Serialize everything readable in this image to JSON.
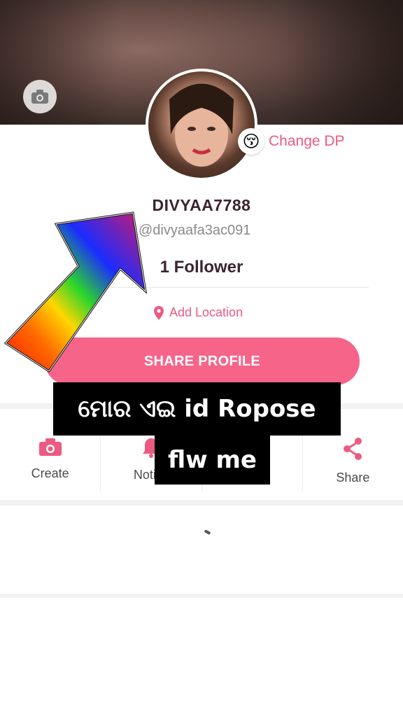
{
  "profile": {
    "username": "DIVYAA7788",
    "handle": "@divyaafa3ac091",
    "followers": "1 Follower",
    "change_dp_label": "Change DP",
    "change_dp_emoji": "😚",
    "add_location_label": "Add Location",
    "share_profile_label": "SHARE PROFILE"
  },
  "actions": [
    {
      "label": "Create",
      "icon": "camera-icon"
    },
    {
      "label": "Notific",
      "icon": "bell-icon"
    },
    {
      "label": "",
      "icon": "unknown"
    },
    {
      "label": "Share",
      "icon": "share-icon"
    }
  ],
  "overlay": {
    "caption_line1": "ମୋର ଏଇ id Ropose",
    "caption_line2": "flw me"
  },
  "colors": {
    "accent": "#ec5a82",
    "button": "#f7648a",
    "text_dark": "#3a2530"
  }
}
